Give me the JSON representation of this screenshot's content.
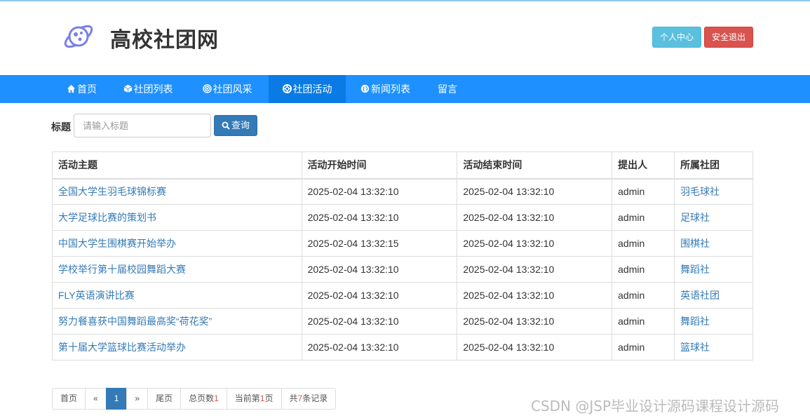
{
  "header": {
    "site_title": "高校社团网",
    "logo_icon": "planet-logo-icon",
    "user_center_label": "个人中心",
    "logout_label": "安全退出"
  },
  "nav": {
    "items": [
      {
        "label": "首页",
        "icon": "home-icon"
      },
      {
        "label": "社团列表",
        "icon": "cube-icon"
      },
      {
        "label": "社团风采",
        "icon": "target-icon"
      },
      {
        "label": "社团活动",
        "icon": "lifebuoy-icon",
        "active": true
      },
      {
        "label": "新闻列表",
        "icon": "globe-icon"
      },
      {
        "label": "留言"
      }
    ]
  },
  "search": {
    "label": "标题",
    "placeholder": "请输入标题",
    "value": "",
    "button_label": "查询"
  },
  "table": {
    "headers": [
      "活动主题",
      "活动开始时间",
      "活动结束时间",
      "提出人",
      "所属社团"
    ],
    "rows": [
      [
        "全国大学生羽毛球锦标赛",
        "2025-02-04 13:32:10",
        "2025-02-04 13:32:10",
        "admin",
        "羽毛球社"
      ],
      [
        "大学足球比赛的策划书",
        "2025-02-04 13:32:10",
        "2025-02-04 13:32:10",
        "admin",
        "足球社"
      ],
      [
        "中国大学生围棋赛开始举办",
        "2025-02-04 13:32:15",
        "2025-02-04 13:32:10",
        "admin",
        "围棋社"
      ],
      [
        "学校举行第十届校园舞蹈大赛",
        "2025-02-04 13:32:10",
        "2025-02-04 13:32:10",
        "admin",
        "舞蹈社"
      ],
      [
        "FLY英语演讲比赛",
        "2025-02-04 13:32:10",
        "2025-02-04 13:32:10",
        "admin",
        "英语社团"
      ],
      [
        "努力餐喜获中国舞蹈最高奖“荷花奖”",
        "2025-02-04 13:32:10",
        "2025-02-04 13:32:10",
        "admin",
        "舞蹈社"
      ],
      [
        "第十届大学篮球比赛活动举办",
        "2025-02-04 13:32:10",
        "2025-02-04 13:32:10",
        "admin",
        "篮球社"
      ]
    ]
  },
  "pager": {
    "first_label": "首页",
    "prev_label": "«",
    "current_page": "1",
    "next_label": "»",
    "last_label": "尾页",
    "total_pages_prefix": "总页数",
    "total_pages": "1",
    "current_prefix": "当前第",
    "current_value": "1",
    "current_suffix": "页",
    "records_prefix": "共",
    "records_count": "7",
    "records_suffix": "条记录"
  },
  "watermark": "CSDN @JSP毕业设计源码课程设计源码",
  "colors": {
    "nav_bg": "#1e90ff",
    "nav_active_bg": "#0a7be4",
    "link": "#337ab7",
    "info_button": "#5bc0de",
    "danger_button": "#d9534f",
    "primary_button": "#337ab7"
  }
}
